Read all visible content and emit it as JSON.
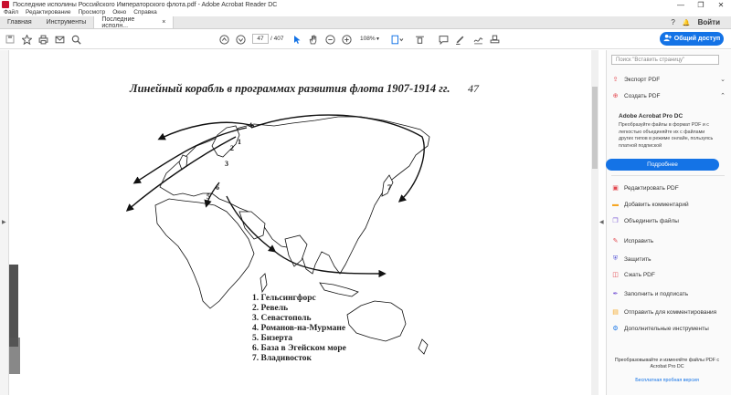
{
  "window": {
    "title": "Последние исполины Российского Императорского флота.pdf - Adobe Acrobat Reader DC",
    "controls": [
      "—",
      "❐",
      "✕"
    ]
  },
  "menu": [
    "Файл",
    "Редактирование",
    "Просмотр",
    "Окно",
    "Справка"
  ],
  "tabs": {
    "home": "Главная",
    "tools": "Инструменты",
    "doc": "Последние исполн...",
    "doc_close": "×"
  },
  "header": {
    "login": "Войти",
    "help": "?",
    "bell": "🔔"
  },
  "toolbar": {
    "page_current": "47",
    "page_total": "/ 407",
    "zoom": "108%",
    "share_label": "Общий доступ"
  },
  "document": {
    "title": "Линейный корабль в программах развития флота 1907-1914 гг.",
    "page_number": "47",
    "legend": [
      "1. Гельсингфорс",
      "2. Ревель",
      "3. Севастополь",
      "4. Романов-на-Мурмане",
      "5. Бизерта",
      "6. База в Эгейском море",
      "7. Владивосток"
    ],
    "map_labels": [
      "4",
      "2",
      "1",
      "3",
      "6",
      "5",
      "7"
    ]
  },
  "right_panel": {
    "search_placeholder": "Поиск \"Вставить страницу\"",
    "export_pdf": "Экспорт PDF",
    "create_pdf": "Создать PDF",
    "promo_title": "Adobe Acrobat Pro DC",
    "promo_text": "Преобразуйте файлы в формат PDF и с легкостью объединяйте их с файлами других типов в режиме онлайн, пользуясь платной подпиской",
    "promo_button": "Подробнее",
    "tools": [
      "Редактировать PDF",
      "Добавить комментарий",
      "Объединить файлы",
      "Исправить",
      "Защитить",
      "Сжать PDF",
      "Заполнить и подписать",
      "Отправить для комментирования",
      "Дополнительные инструменты"
    ],
    "footer_text": "Преобразовывайте и изменяйте файлы PDF с Acrobat Pro DC",
    "footer_link": "Бесплатная пробная версия"
  },
  "colors": {
    "accent": "#1473e6",
    "tool_icons": [
      "#e34850",
      "#f5a623",
      "#7c5cd6",
      "#e34850",
      "#5a5ad6",
      "#e34850",
      "#7c5cd6",
      "#f5a623",
      "#1473e6"
    ]
  }
}
